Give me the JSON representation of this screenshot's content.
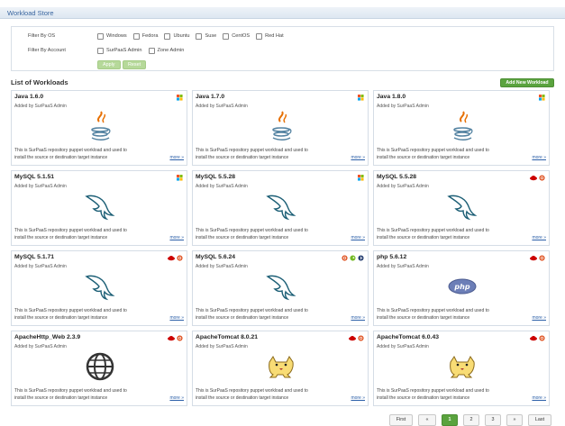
{
  "header": {
    "title": "Workload Store"
  },
  "filters": {
    "os_label": "Filter By OS",
    "os_options": [
      "Windows",
      "Fedora",
      "Ubuntu",
      "Suse",
      "CentOS",
      "Red Hat"
    ],
    "account_label": "Filter By Account",
    "account_options": [
      "SurPaaS Admin",
      "Zone Admin"
    ],
    "apply_label": "Apply",
    "reset_label": "Reset"
  },
  "list": {
    "title": "List of Workloads",
    "add_label": "Add New Workload"
  },
  "workloads": [
    {
      "name": "Java 1.6.0",
      "added_by": "Added by SurPaaS Admin",
      "logo": "java-icon",
      "os": [
        "windows-icon"
      ]
    },
    {
      "name": "Java 1.7.0",
      "added_by": "Added by SurPaaS Admin",
      "logo": "java-icon",
      "os": [
        "windows-icon"
      ]
    },
    {
      "name": "Java 1.8.0",
      "added_by": "Added by SurPaaS Admin",
      "logo": "java-icon",
      "os": [
        "windows-icon"
      ]
    },
    {
      "name": "MySQL 5.1.51",
      "added_by": "Added by SurPaaS Admin",
      "logo": "mysql-dolphin-icon",
      "os": [
        "windows-icon"
      ]
    },
    {
      "name": "MySQL 5.5.28",
      "added_by": "Added by SurPaaS Admin",
      "logo": "mysql-dolphin-icon",
      "os": [
        "windows-icon"
      ]
    },
    {
      "name": "MySQL 5.5.28",
      "added_by": "Added by SurPaaS Admin",
      "logo": "mysql-dolphin-icon",
      "os": [
        "redhat-icon",
        "ubuntu-icon"
      ]
    },
    {
      "name": "MySQL 5.1.71",
      "added_by": "Added by SurPaaS Admin",
      "logo": "mysql-dolphin-icon",
      "os": [
        "redhat-icon",
        "ubuntu-icon"
      ]
    },
    {
      "name": "MySQL 5.6.24",
      "added_by": "Added by SurPaaS Admin",
      "logo": "mysql-dolphin-icon",
      "os": [
        "ubuntu-icon",
        "suse-icon",
        "fedora-icon"
      ]
    },
    {
      "name": "php 5.6.12",
      "added_by": "Added by SurPaaS Admin",
      "logo": "php-icon",
      "os": [
        "redhat-icon",
        "ubuntu-icon"
      ]
    },
    {
      "name": "ApacheHttp_Web 2.3.9",
      "added_by": "Added by SurPaaS Admin",
      "logo": "globe-icon",
      "os": [
        "redhat-icon",
        "ubuntu-icon"
      ]
    },
    {
      "name": "ApacheTomcat 8.0.21",
      "added_by": "Added by SurPaaS Admin",
      "logo": "tomcat-icon",
      "os": [
        "redhat-icon",
        "ubuntu-icon"
      ]
    },
    {
      "name": "ApacheTomcat 6.0.43",
      "added_by": "Added by SurPaaS Admin",
      "logo": "tomcat-icon",
      "os": [
        "redhat-icon",
        "ubuntu-icon"
      ]
    }
  ],
  "card_desc_line1": "This is SurPaaS repository puppet workload and used to",
  "card_desc_line2": "install the source or destination target instance",
  "card_more": "more »",
  "pagination": {
    "first": "First",
    "prev": "«",
    "pages": [
      "1",
      "2",
      "3"
    ],
    "current": "1",
    "next": "»",
    "last": "Last"
  },
  "colors": {
    "accent": "#5aa33e",
    "link": "#2b5fa8",
    "title": "#3a66a0"
  }
}
